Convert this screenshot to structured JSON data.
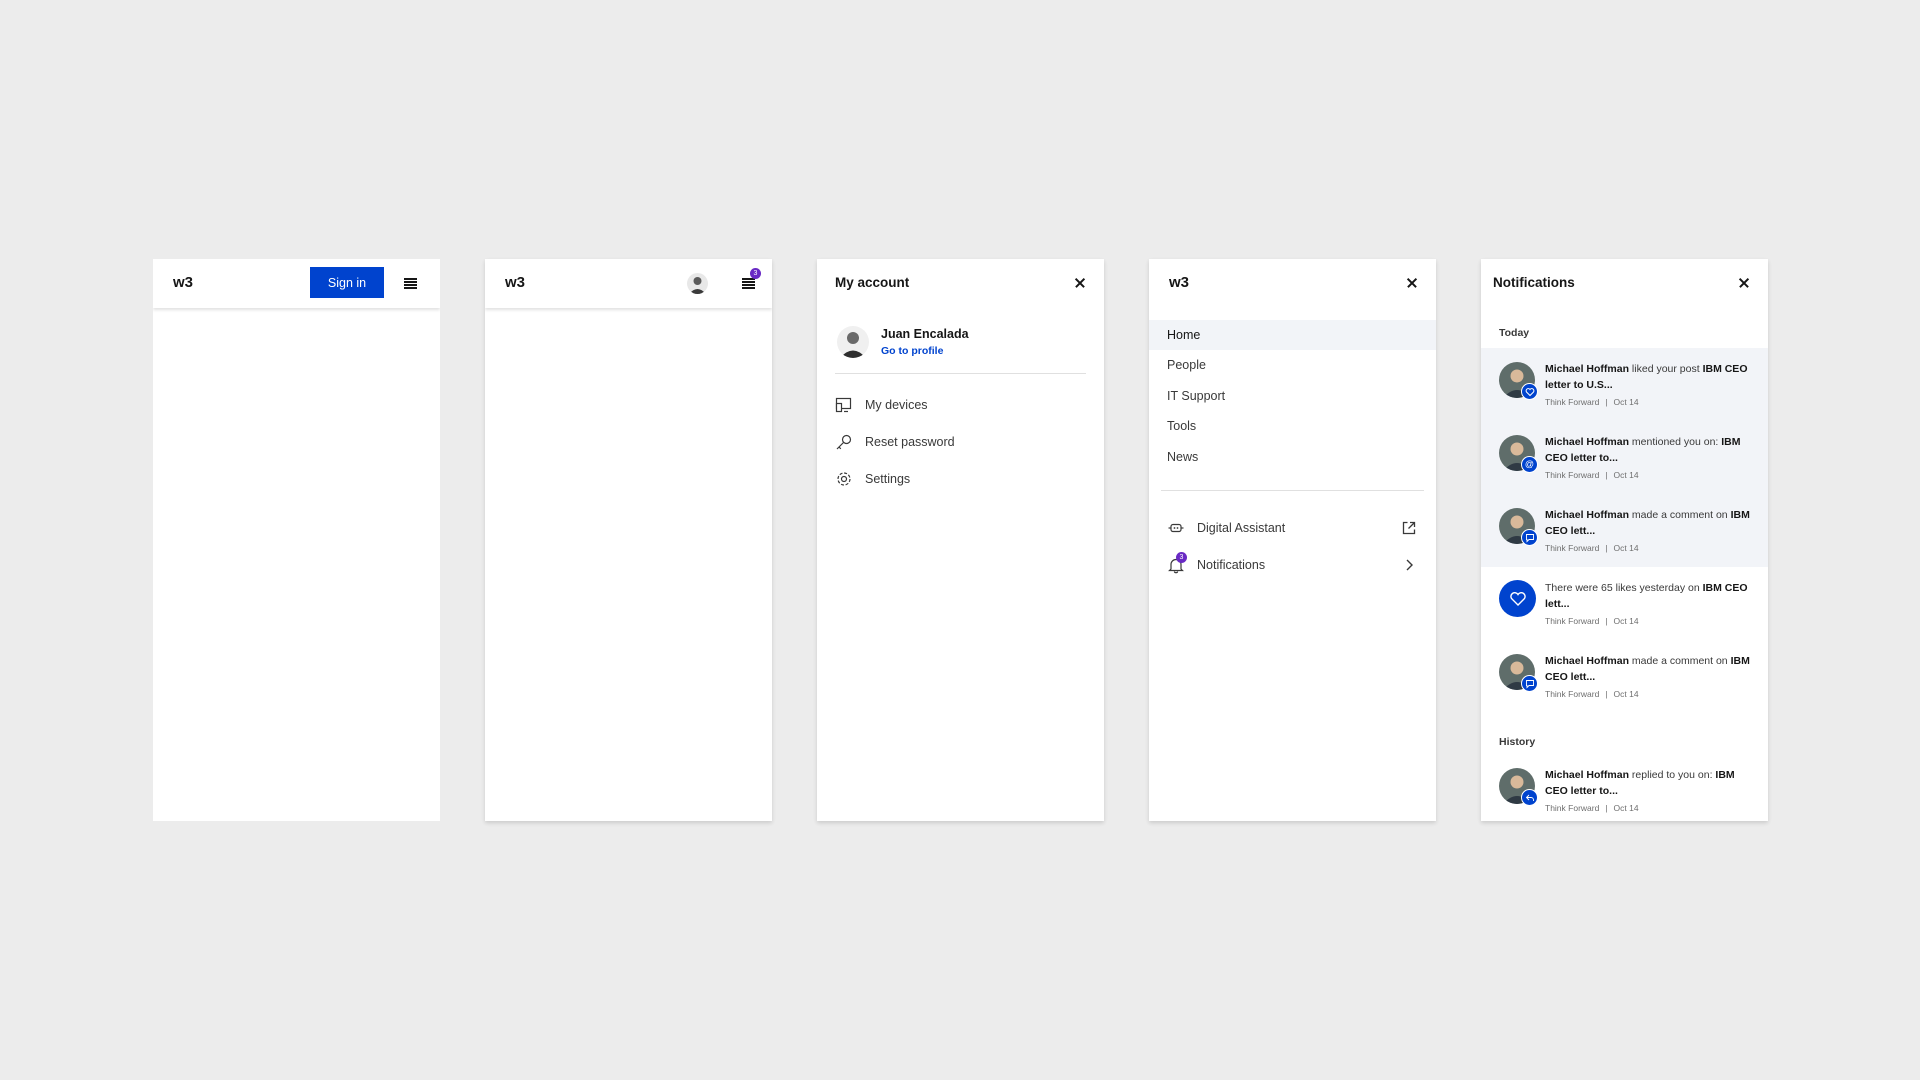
{
  "panel1": {
    "brand": "w3",
    "signin_label": "Sign in"
  },
  "panel2": {
    "brand": "w3",
    "menu_badge": "3"
  },
  "panel3": {
    "title": "My account",
    "user_name": "Juan Encalada",
    "profile_link": "Go to profile",
    "items": [
      {
        "label": "My devices",
        "icon": "devices-icon"
      },
      {
        "label": "Reset password",
        "icon": "key-icon"
      },
      {
        "label": "Settings",
        "icon": "gear-icon"
      }
    ]
  },
  "panel4": {
    "brand": "w3",
    "nav": [
      "Home",
      "People",
      "IT Support",
      "Tools",
      "News"
    ],
    "active": "Home",
    "assistant_label": "Digital Assistant",
    "notifications_label": "Notifications",
    "notifications_badge": "3"
  },
  "panel5": {
    "title": "Notifications",
    "today_label": "Today",
    "history_label": "History",
    "items": [
      {
        "actor": "Michael Hoffman",
        "action": " liked your post ",
        "target": "IBM CEO letter to U.S...",
        "source": "Think Forward",
        "date": "Oct 14",
        "type": "like"
      },
      {
        "actor": "Michael Hoffman",
        "action": " mentioned you on: ",
        "target": "IBM CEO letter to...",
        "source": "Think Forward",
        "date": "Oct 14",
        "type": "mention"
      },
      {
        "actor": "Michael Hoffman",
        "action": " made a comment on ",
        "target": "IBM CEO lett...",
        "source": "Think Forward",
        "date": "Oct 14",
        "type": "comment"
      },
      {
        "actor": "",
        "action": "There were 65 likes yesterday on ",
        "target": "IBM CEO lett...",
        "source": "Think Forward",
        "date": "Oct 14",
        "type": "summary"
      },
      {
        "actor": "Michael Hoffman",
        "action": " made a comment on ",
        "target": "IBM CEO lett...",
        "source": "Think Forward",
        "date": "Oct 14",
        "type": "comment"
      },
      {
        "actor": "Michael Hoffman",
        "action": " replied to you on: ",
        "target": "IBM CEO letter to...",
        "source": "Think Forward",
        "date": "Oct 14",
        "type": "reply"
      }
    ]
  },
  "colors": {
    "accent": "#0043ce",
    "badge": "#6929c4",
    "unread_bg": "#f2f4f8",
    "page_bg": "#ececec"
  }
}
